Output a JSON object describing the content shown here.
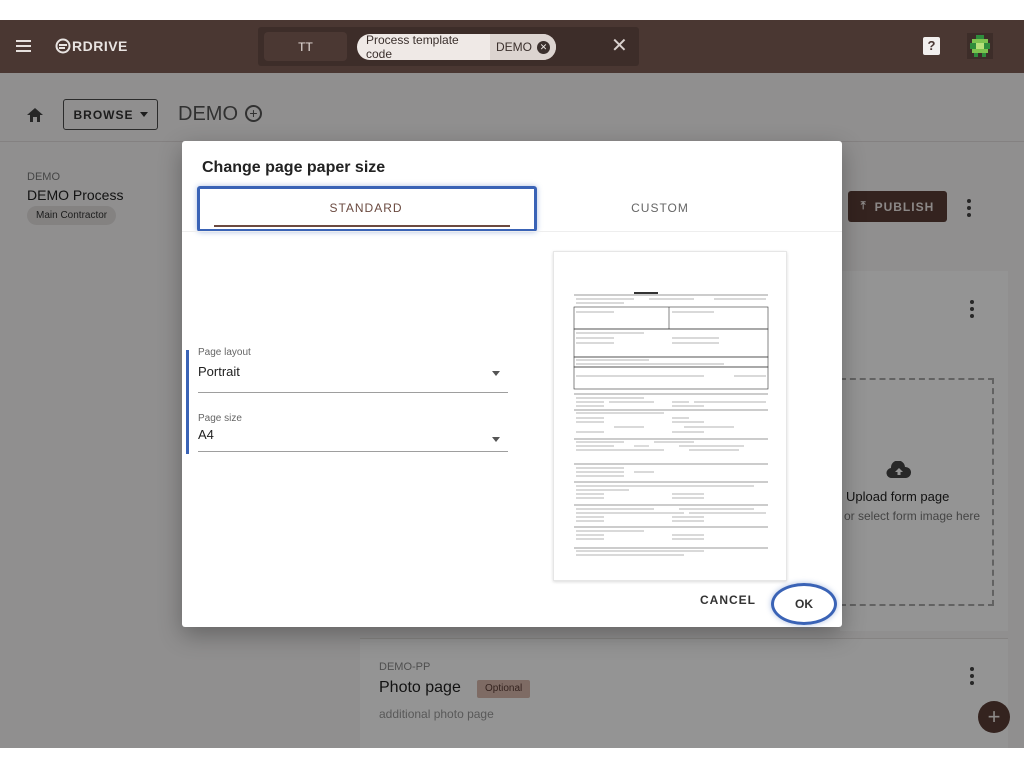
{
  "appbar": {
    "brand": "RDRIVE",
    "search_chip": "TT",
    "filter_key": "Process template code",
    "filter_value": "DEMO",
    "close_glyph": "✕",
    "help_glyph": "?"
  },
  "breadcrumb": {
    "browse_label": "BROWSE",
    "title": "DEMO",
    "add_glyph": "+"
  },
  "process": {
    "code": "DEMO",
    "name": "DEMO Process",
    "role_chip": "Main Contractor",
    "publish_label": "PUBLISH",
    "publish_icon": "⤒"
  },
  "upload": {
    "title": "Upload form page",
    "subtitle": "or select form image here"
  },
  "photo_page": {
    "code": "DEMO-PP",
    "title": "Photo page",
    "badge": "Optional",
    "subtitle": "additional photo page"
  },
  "fab": {
    "glyph": "+"
  },
  "dialog": {
    "title": "Change page paper size",
    "tabs": [
      {
        "label": "STANDARD",
        "active": true
      },
      {
        "label": "CUSTOM",
        "active": false
      }
    ],
    "layout_field": {
      "label": "Page layout",
      "value": "Portrait"
    },
    "size_field": {
      "label": "Page size",
      "value": "A4"
    },
    "cancel_label": "CANCEL",
    "ok_label": "OK"
  },
  "colors": {
    "appbar": "#4a3732",
    "accent": "#6b4a40",
    "highlight": "#3a63b6"
  },
  "icons": [
    "menu-icon",
    "home-icon",
    "help-icon",
    "upload-cloud-icon",
    "add-icon",
    "kebab-icon",
    "chip-close-icon",
    "close-icon",
    "dropdown-arrow-icon"
  ]
}
